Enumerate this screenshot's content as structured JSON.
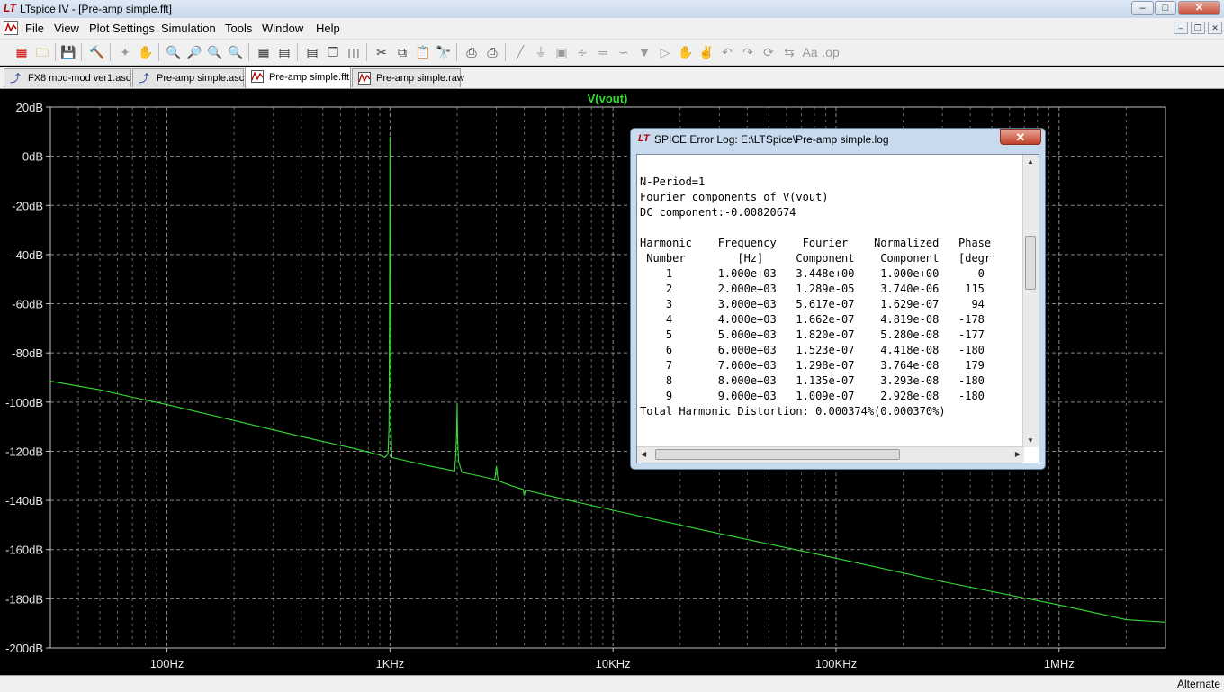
{
  "window": {
    "title": "LTspice IV - [Pre-amp simple.fft]",
    "min_label": "–",
    "max_label": "□",
    "close_label": "✕"
  },
  "menu": [
    "File",
    "View",
    "Plot Settings",
    "Simulation",
    "Tools",
    "Window",
    "Help"
  ],
  "tabs": [
    {
      "label": "FX8 mod-mod ver1.asc",
      "icon": "schematic-icon",
      "active": false
    },
    {
      "label": "Pre-amp simple.asc",
      "icon": "schematic-icon",
      "active": false
    },
    {
      "label": "Pre-amp simple.fft",
      "icon": "waveform-icon",
      "active": true
    },
    {
      "label": "Pre-amp simple.raw",
      "icon": "waveform-icon",
      "active": false
    }
  ],
  "status": {
    "text": "Alternate"
  },
  "dialog": {
    "title": "SPICE Error Log: E:\\LTSpice\\Pre-amp simple.log",
    "close_label": "✕",
    "lines": [
      "N-Period=1",
      "Fourier components of V(vout)",
      "DC component:-0.00820674",
      "",
      "Harmonic    Frequency    Fourier    Normalized   Phase",
      " Number        [Hz]     Component    Component   [degr",
      "    1       1.000e+03   3.448e+00    1.000e+00     -0",
      "    2       2.000e+03   1.289e-05    3.740e-06    115",
      "    3       3.000e+03   5.617e-07    1.629e-07     94",
      "    4       4.000e+03   1.662e-07    4.819e-08   -178",
      "    5       5.000e+03   1.820e-07    5.280e-08   -177",
      "    6       6.000e+03   1.523e-07    4.418e-08   -180",
      "    7       7.000e+03   1.298e-07    3.764e-08    179",
      "    8       8.000e+03   1.135e-07    3.293e-08   -180",
      "    9       9.000e+03   1.009e-07    2.928e-08   -180",
      "Total Harmonic Distortion: 0.000374%(0.000370%)"
    ]
  },
  "chart_data": {
    "type": "line",
    "title": "V(vout)",
    "x_scale": "log",
    "xlim": [
      30,
      3000000
    ],
    "ylim": [
      -200,
      20
    ],
    "x_ticks": [
      {
        "value": 100,
        "label": "100Hz"
      },
      {
        "value": 1000,
        "label": "1KHz"
      },
      {
        "value": 10000,
        "label": "10KHz"
      },
      {
        "value": 100000,
        "label": "100KHz"
      },
      {
        "value": 1000000,
        "label": "1MHz"
      }
    ],
    "y_ticks": [
      {
        "value": 20,
        "label": "20dB"
      },
      {
        "value": 0,
        "label": "0dB"
      },
      {
        "value": -20,
        "label": "-20dB"
      },
      {
        "value": -40,
        "label": "-40dB"
      },
      {
        "value": -60,
        "label": "-60dB"
      },
      {
        "value": -80,
        "label": "-80dB"
      },
      {
        "value": -100,
        "label": "-100dB"
      },
      {
        "value": -120,
        "label": "-120dB"
      },
      {
        "value": -140,
        "label": "-140dB"
      },
      {
        "value": -160,
        "label": "-160dB"
      },
      {
        "value": -180,
        "label": "-180dB"
      },
      {
        "value": -200,
        "label": "-200dB"
      }
    ],
    "grid": true,
    "color": "#33dd33",
    "series": [
      {
        "x": [
          30,
          40,
          50,
          70,
          100,
          200,
          400,
          700,
          900,
          950,
          980,
          990,
          995,
          1000,
          1005,
          1010,
          1020,
          1050,
          1500,
          1950,
          1970,
          1990,
          2000,
          2010,
          2030,
          2100,
          2500,
          2950,
          2980,
          3000,
          3020,
          3050,
          3500,
          3950,
          4000,
          4050,
          5000,
          10000,
          30000,
          100000,
          300000,
          1000000,
          2000000,
          3000000
        ],
        "y": [
          -91.5,
          -93.5,
          -95,
          -98,
          -101,
          -107.5,
          -114,
          -119,
          -121.5,
          -122.5,
          -121,
          -110,
          -60,
          8,
          -60,
          -110,
          -122.5,
          -122.8,
          -126,
          -128,
          -122,
          -112,
          -100.5,
          -115,
          -124,
          -128.6,
          -130,
          -131.5,
          -128,
          -126,
          -128,
          -132,
          -134,
          -135.5,
          -138,
          -135.8,
          -137.8,
          -144,
          -153.5,
          -163.5,
          -173,
          -182.5,
          -188.5,
          -189.5
        ]
      }
    ]
  }
}
